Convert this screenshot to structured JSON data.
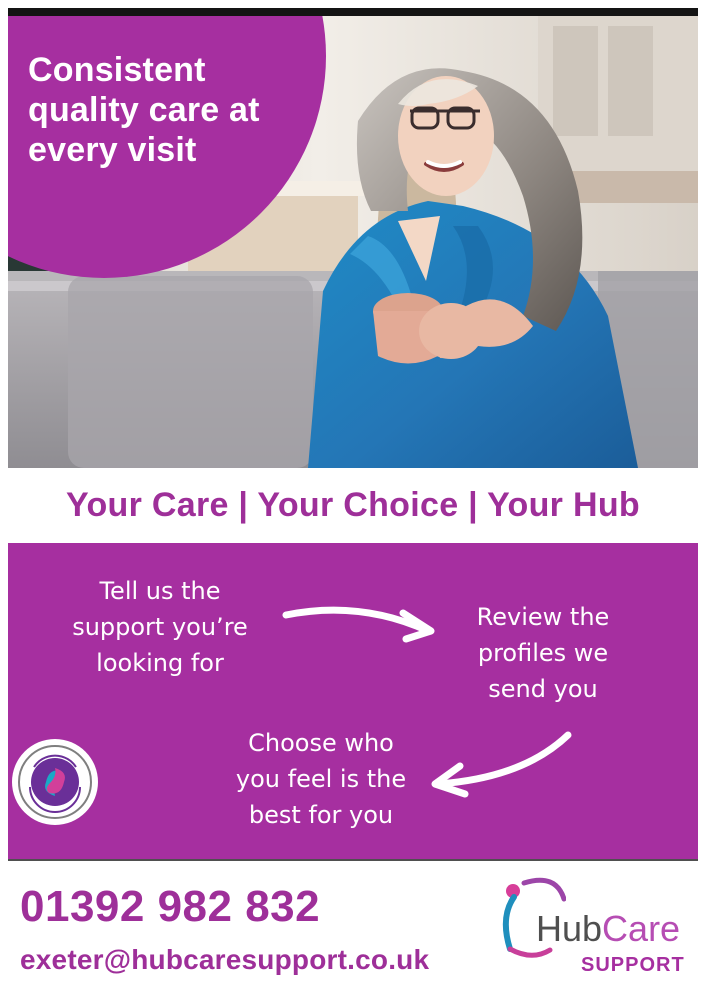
{
  "headline": {
    "lines": [
      "Consistent",
      "quality care at",
      "every visit"
    ]
  },
  "tagline": "Your Care | Your Choice | Your Hub",
  "steps": [
    {
      "lines": [
        "Tell us the",
        "support you’re",
        "looking for"
      ]
    },
    {
      "lines": [
        "Review the",
        "profiles we",
        "send you"
      ]
    },
    {
      "lines": [
        "Choose who",
        "you feel is the",
        "best for you"
      ]
    }
  ],
  "contact": {
    "phone": "01392 982 832",
    "email": "exeter@hubcaresupport.co.uk"
  },
  "logo": {
    "hub": "Hub",
    "care": "Care",
    "support": "SUPPORT"
  },
  "colors": {
    "brand_purple": "#a62fa0",
    "text_purple": "#9e2f99",
    "logo_grey": "#4f4f4f",
    "logo_pink": "#b64db3",
    "white": "#ffffff"
  },
  "icons": {
    "badge": "quality-care-badge-icon",
    "arrow_right": "curved-arrow-right-icon",
    "arrow_left": "curved-arrow-left-icon",
    "logo_mark": "hubcare-figure-icon"
  }
}
